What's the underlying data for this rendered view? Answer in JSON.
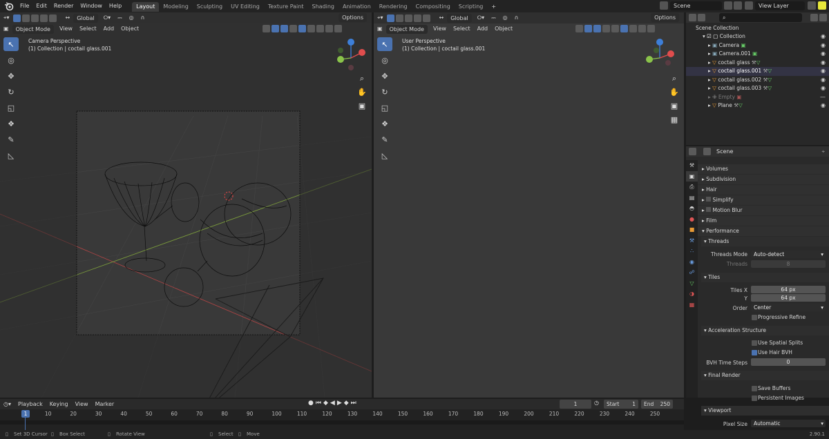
{
  "menu": [
    "File",
    "Edit",
    "Render",
    "Window",
    "Help"
  ],
  "workspaces": [
    {
      "label": "Layout",
      "active": true
    },
    {
      "label": "Modeling"
    },
    {
      "label": "Sculpting"
    },
    {
      "label": "UV Editing"
    },
    {
      "label": "Texture Paint"
    },
    {
      "label": "Shading"
    },
    {
      "label": "Animation"
    },
    {
      "label": "Rendering"
    },
    {
      "label": "Compositing"
    },
    {
      "label": "Scripting"
    }
  ],
  "scene_field": "Scene",
  "view_layer_field": "View Layer",
  "viewport_left": {
    "orientation": "Global",
    "options": "Options",
    "mode": "Object Mode",
    "menus": [
      "View",
      "Select",
      "Add",
      "Object"
    ],
    "info_line1": "Camera Perspective",
    "info_line2": "(1) Collection | coctail glass.001"
  },
  "viewport_right": {
    "orientation": "Global",
    "options": "Options",
    "mode": "Object Mode",
    "menus": [
      "View",
      "Select",
      "Add",
      "Object"
    ],
    "info_line1": "User Perspective",
    "info_line2": "(1) Collection | coctail glass.001"
  },
  "outliner": {
    "root": "Scene Collection",
    "collection": "Collection",
    "items": [
      {
        "name": "Camera"
      },
      {
        "name": "Camera.001"
      },
      {
        "name": "coctail glass"
      },
      {
        "name": "coctail glass.001"
      },
      {
        "name": "coctail glass.002"
      },
      {
        "name": "coctail glass.003"
      },
      {
        "name": "Empty",
        "dim": true
      },
      {
        "name": "Plane"
      }
    ]
  },
  "properties": {
    "header": "Scene",
    "panels": [
      "Volumes",
      "Subdivision",
      "Hair",
      "Simplify",
      "Motion Blur",
      "Film",
      "Performance"
    ],
    "threads": {
      "title": "Threads",
      "mode_label": "Threads Mode",
      "mode_value": "Auto-detect",
      "threads_label": "Threads",
      "threads_value": "8"
    },
    "tiles": {
      "title": "Tiles",
      "x_label": "Tiles X",
      "x_value": "64 px",
      "y_label": "Y",
      "y_value": "64 px",
      "order_label": "Order",
      "order_value": "Center",
      "progressive": "Progressive Refine"
    },
    "accel": {
      "title": "Acceleration Structure",
      "spatial_splits": "Use Spatial Splits",
      "hair_bvh": "Use Hair BVH",
      "bvh_steps_label": "BVH Time Steps",
      "bvh_steps_value": "0"
    },
    "final_render": {
      "title": "Final Render",
      "save_buffers": "Save Buffers",
      "persistent_images": "Persistent Images"
    },
    "viewport": {
      "title": "Viewport",
      "pixel_size_label": "Pixel Size",
      "pixel_size_value": "Automatic"
    }
  },
  "timeline": {
    "menus": [
      "Playback",
      "Keying",
      "View",
      "Marker"
    ],
    "current_frame": "1",
    "start_label": "Start",
    "start_value": "1",
    "end_label": "End",
    "end_value": "250",
    "frames": [
      "1",
      "10",
      "20",
      "30",
      "40",
      "50",
      "60",
      "70",
      "80",
      "90",
      "100",
      "110",
      "120",
      "130",
      "140",
      "150",
      "160",
      "170",
      "180",
      "190",
      "200",
      "210",
      "220",
      "230",
      "240",
      "250"
    ]
  },
  "status": {
    "hint1": "Set 3D Cursor",
    "hint2": "Box Select",
    "hint3": "Rotate View",
    "hint4": "Select",
    "hint5": "Move",
    "version": "2.90.1"
  },
  "colors": {
    "accent": "#4a72b0",
    "active_object": "#e89a35",
    "x_axis": "#e04d4d",
    "y_axis": "#8ac34a",
    "z_axis": "#3d7fd9"
  }
}
